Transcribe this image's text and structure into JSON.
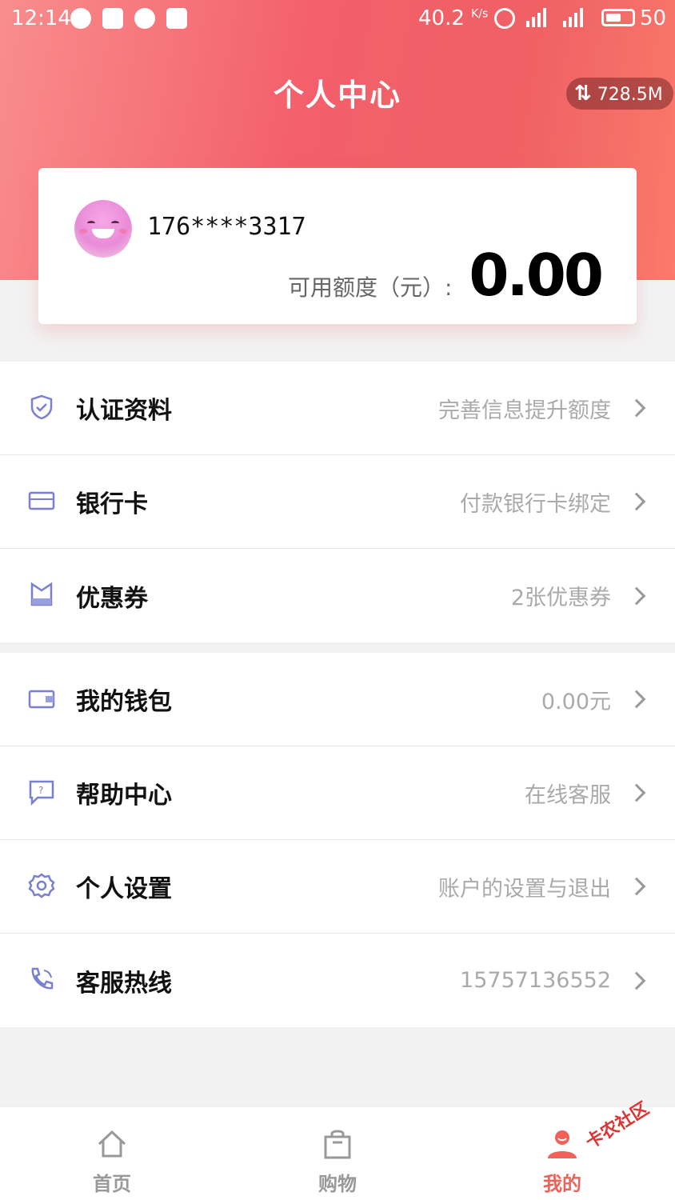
{
  "status_bar": {
    "time": "12:14",
    "net_speed": "40.2",
    "net_unit": "K/s",
    "battery_level": "50"
  },
  "header": {
    "title": "个人中心",
    "traffic_badge": "728.5M",
    "color_accent": "#f35f6a"
  },
  "profile": {
    "phone": "176****3317",
    "credit_label": "可用额度（元）:",
    "credit_value": "0.00"
  },
  "menu_group_1": [
    {
      "icon": "shield-check-icon",
      "label": "认证资料",
      "hint": "完善信息提升额度"
    },
    {
      "icon": "bank-card-icon",
      "label": "银行卡",
      "hint": "付款银行卡绑定"
    },
    {
      "icon": "coupon-icon",
      "label": "优惠券",
      "hint": "2张优惠券"
    }
  ],
  "menu_group_2": [
    {
      "icon": "wallet-icon",
      "label": "我的钱包",
      "hint": "0.00元"
    },
    {
      "icon": "help-chat-icon",
      "label": "帮助中心",
      "hint": "在线客服"
    },
    {
      "icon": "gear-icon",
      "label": "个人设置",
      "hint": "账户的设置与退出"
    },
    {
      "icon": "phone-icon",
      "label": "客服热线",
      "hint": "15757136552"
    }
  ],
  "tabbar": {
    "tabs": [
      {
        "icon": "home-icon",
        "label": "首页",
        "active": false
      },
      {
        "icon": "shopping-bag-icon",
        "label": "购物",
        "active": false
      },
      {
        "icon": "user-icon",
        "label": "我的",
        "active": true
      }
    ],
    "active_color": "#f0615a"
  },
  "watermark": "卡农社区"
}
